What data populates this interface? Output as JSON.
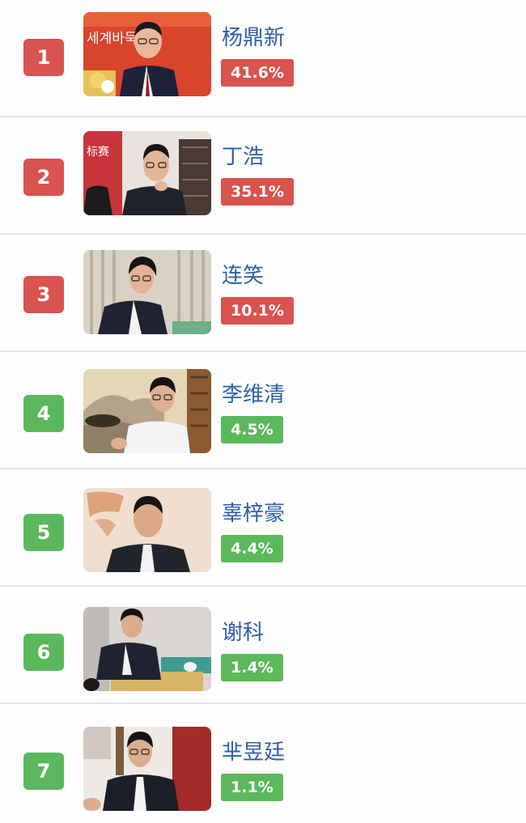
{
  "colors": {
    "top_rank": "#d9534f",
    "other_rank": "#5cb85c",
    "name_text": "#2f5fa6",
    "divider": "#e4e4e4"
  },
  "players": [
    {
      "rank": "1",
      "name": "杨鼎新",
      "probability": "41.6%",
      "photo_text": "세계바둑최강",
      "badge": "red"
    },
    {
      "rank": "2",
      "name": "丁浩",
      "probability": "35.1%",
      "photo_text": "标赛",
      "badge": "red"
    },
    {
      "rank": "3",
      "name": "连笑",
      "probability": "10.1%",
      "badge": "red"
    },
    {
      "rank": "4",
      "name": "李维清",
      "probability": "4.5%",
      "badge": "green"
    },
    {
      "rank": "5",
      "name": "辜梓豪",
      "probability": "4.4%",
      "badge": "green"
    },
    {
      "rank": "6",
      "name": "谢科",
      "probability": "1.4%",
      "badge": "green"
    },
    {
      "rank": "7",
      "name": "芈昱廷",
      "probability": "1.1%",
      "badge": "green"
    }
  ]
}
